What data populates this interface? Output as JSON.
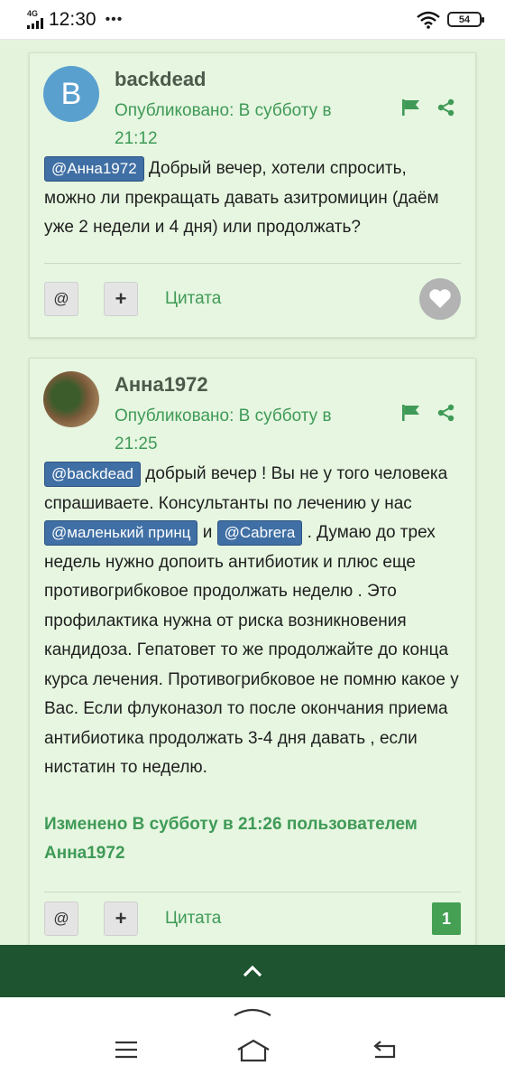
{
  "status_bar": {
    "network": "4G",
    "time": "12:30",
    "more": "•••",
    "battery": "54"
  },
  "posts": [
    {
      "avatar_letter": "B",
      "author": "backdead",
      "meta": "Опубликовано: В субботу в 21:12",
      "mention": "@Анна1972",
      "body": " Добрый вечер, хотели спросить, можно ли прекращать давать азитромицин (даём уже 2 недели и 4 дня) или продолжать?",
      "actions": {
        "mention_btn": "@",
        "plus_btn": "+",
        "quote": "Цитата"
      }
    },
    {
      "author": "Анна1972",
      "meta": "Опубликовано: В субботу в 21:25",
      "mention1": "@backdead",
      "text1": "  добрый вечер ! Вы не у того человека спрашиваете. Консультанты по лечению у нас ",
      "mention2": "@маленький принц",
      "text2": " и ",
      "mention3": "@Cabrera",
      "text3": " . Думаю до трех недель нужно допоить антибиотик и плюс еще противогрибковое продолжать неделю . Это профилактика нужна от риска возникновения кандидоза. Гепатовет то же продолжайте до конца курса лечения. Противогрибковое не помню какое у Вас. Если флуконазол то после окончания приема антибиотика продолжать 3-4 дня давать , если нистатин то неделю.",
      "edited": "Изменено В субботу в 21:26 пользователем Анна1972",
      "actions": {
        "mention_btn": "@",
        "plus_btn": "+",
        "quote": "Цитата",
        "likes": "1"
      }
    }
  ],
  "colors": {
    "page_bg": "#e4f4dc",
    "accent_green": "#3f9a57",
    "mention_blue": "#3f6fa4",
    "bottom_bar": "#1e5430"
  }
}
